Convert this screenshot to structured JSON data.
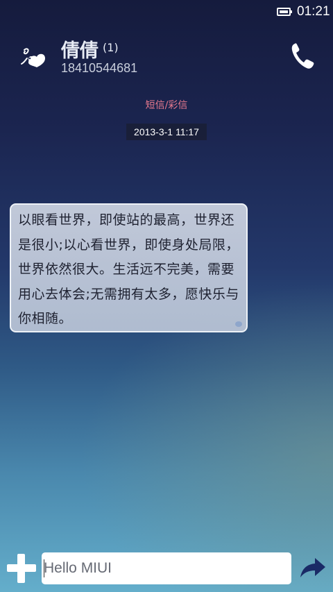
{
  "status_bar": {
    "time": "01:21",
    "battery_icon": "battery-full-icon"
  },
  "header": {
    "avatar_icon": "contact-avatar-icon",
    "contact_name": "倩倩",
    "unread_count": "(1)",
    "contact_number": "18410544681",
    "call_icon": "phone-icon"
  },
  "conversation": {
    "message_type": "短信/彩信",
    "timestamp": "2013-3-1 11:17",
    "messages": [
      {
        "direction": "incoming",
        "text": "以眼看世界，即使站的最高，世界还是很小;以心看世界，即使身处局限，世界依然很大。生活远不完美，需要用心去体会;无需拥有太多，愿快乐与你相随。"
      }
    ]
  },
  "composer": {
    "add_icon": "plus-icon",
    "input_value": "Hello MIUI",
    "send_icon": "send-arrow-icon"
  },
  "colors": {
    "background_top": "#151b3d",
    "background_bottom": "#64aecb",
    "message_type_color": "#e7798e",
    "bubble_fill": "#c5cddd",
    "bubble_border": "#eef2f7"
  }
}
